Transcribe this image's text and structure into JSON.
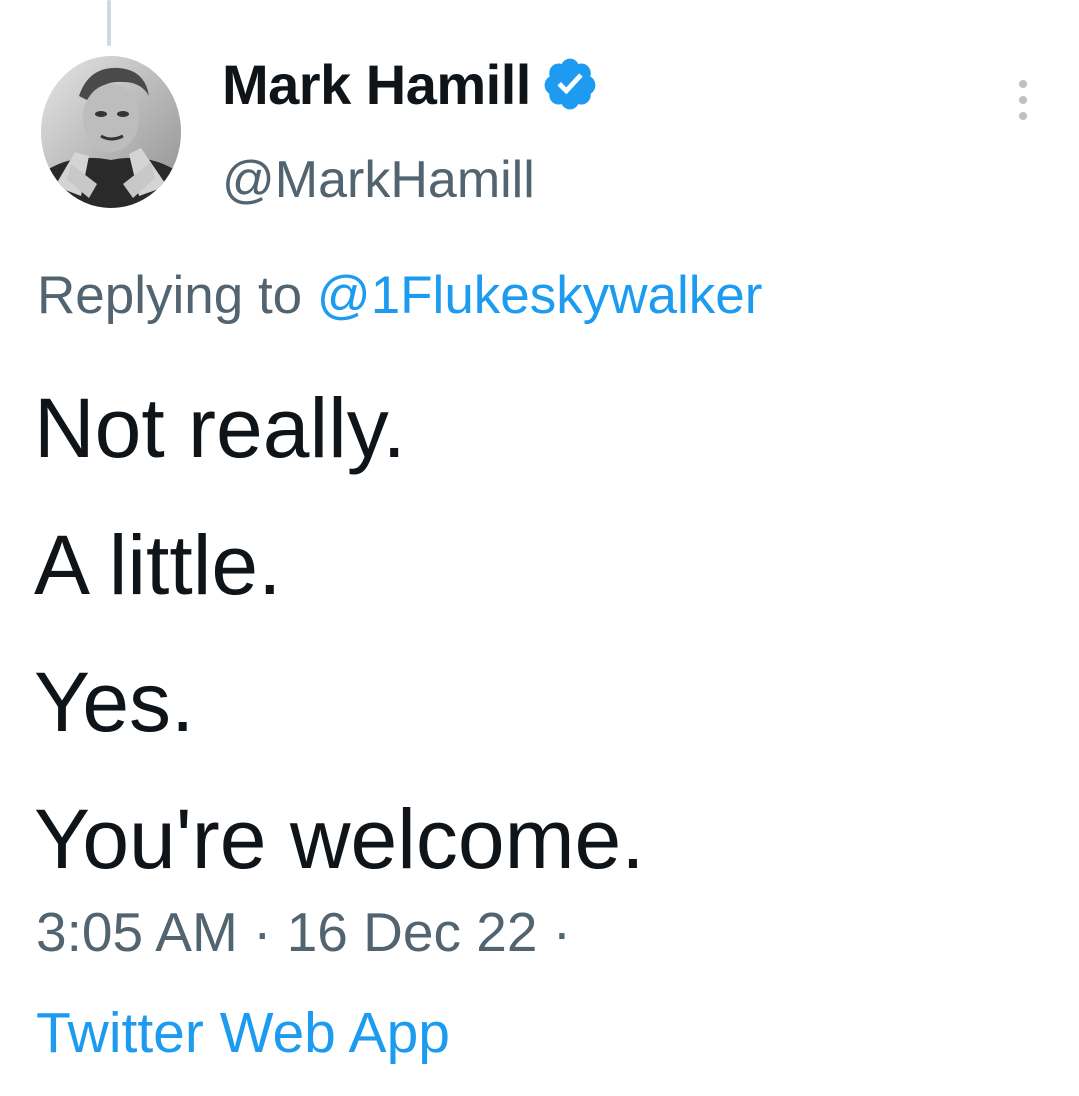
{
  "tweet": {
    "author": {
      "display_name": "Mark Hamill",
      "handle": "@MarkHamill",
      "verified": true,
      "verified_color": "#1d9bf0"
    },
    "reply": {
      "prefix": "Replying to",
      "mention": "@1Flukeskywalker"
    },
    "lines": [
      "Not really.",
      "A little.",
      "Yes.",
      "You're welcome."
    ],
    "time": "3:05 AM",
    "separator": "·",
    "date": "16 Dec 22",
    "source": "Twitter Web App"
  },
  "icons": {
    "verified": "verified-badge-icon",
    "more": "more-options-icon"
  },
  "colors": {
    "text": "#0f1419",
    "secondary": "#536471",
    "link": "#1d9bf0"
  }
}
